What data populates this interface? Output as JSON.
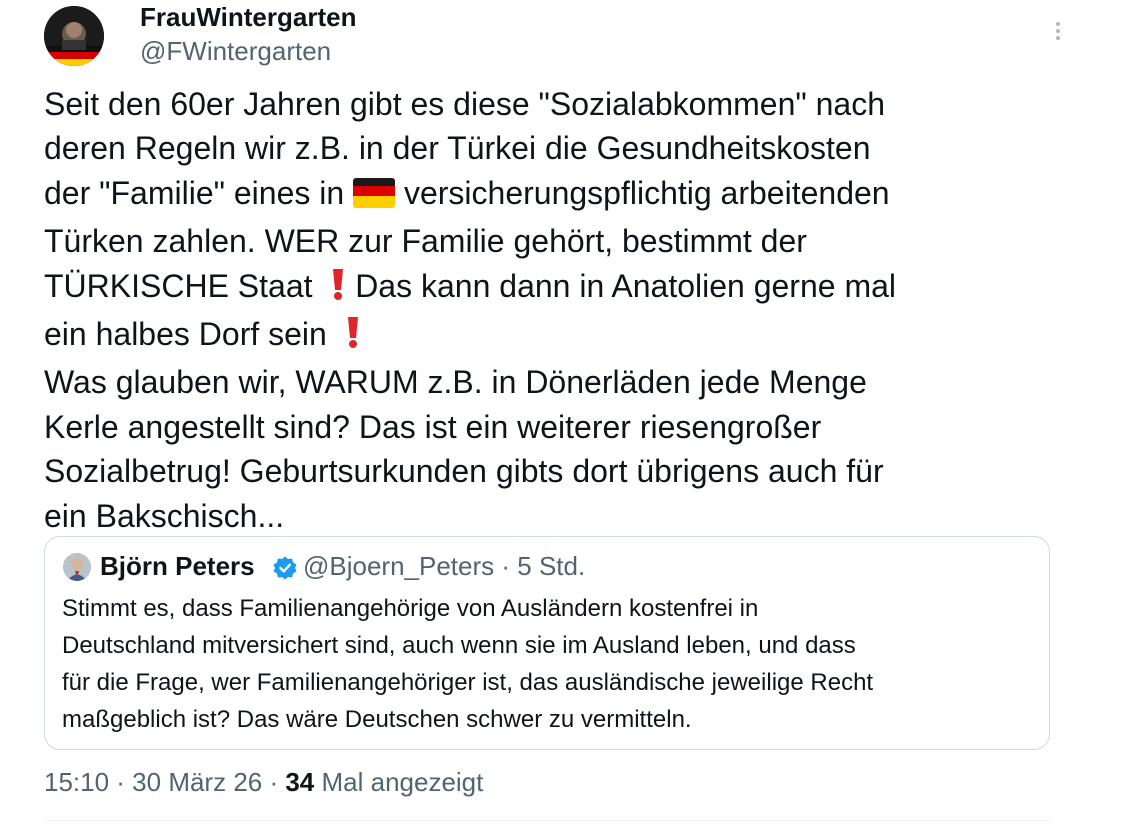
{
  "author": {
    "display_name": "FrauWintergarten",
    "handle": "@FWintergarten",
    "avatar_icon": "avatar-photo-icon"
  },
  "more_icon": "more-options-icon",
  "tweet": {
    "lines": {
      "l1": "Seit den 60er Jahren gibt es diese \"Sozialabkommen\" nach",
      "l2": "deren Regeln wir z.B. in der Türkei die Gesundheitskosten",
      "l3a": "der \"Familie\" eines in",
      "l3b": "versicherungspflichtig arbeitenden",
      "l4": "Türken zahlen. WER zur Familie gehört, bestimmt der",
      "l5a": "TÜRKISCHE Staat",
      "l5b": "Das kann dann in Anatolien gerne mal",
      "l6": "ein halbes Dorf sein",
      "l7": "Was glauben wir, WARUM z.B. in Dönerläden jede Menge",
      "l8": "Kerle angestellt sind? Das ist ein weiterer riesengroßer",
      "l9": "Sozialbetrug! Geburtsurkunden gibts dort übrigens auch für",
      "l10": "ein Bakschisch..."
    },
    "emojis": [
      "german-flag-icon",
      "exclamation-mark-icon"
    ]
  },
  "quote": {
    "display_name": "Björn Peters",
    "handle_time": "@Bjoern_Peters · 5 Std.",
    "verified_color": "#1d9bf0",
    "lines": {
      "l1": "Stimmt es, dass Familienangehörige von Ausländern kostenfrei in",
      "l2": "Deutschland mitversichert sind, auch wenn sie im Ausland leben, und dass",
      "l3": "für die Frage, wer Familienangehöriger ist, das ausländische jeweilige Recht",
      "l4": "maßgeblich ist? Das wäre Deutschen schwer zu vermitteln."
    }
  },
  "footer": {
    "timestamp": "15:10 · 30 März 26 · ",
    "view_count": "34",
    "views_label": " Mal angezeigt"
  },
  "colors": {
    "text_primary": "#0f1419",
    "text_secondary": "#536471",
    "border": "#cfd9de",
    "accent": "#1d9bf0"
  }
}
